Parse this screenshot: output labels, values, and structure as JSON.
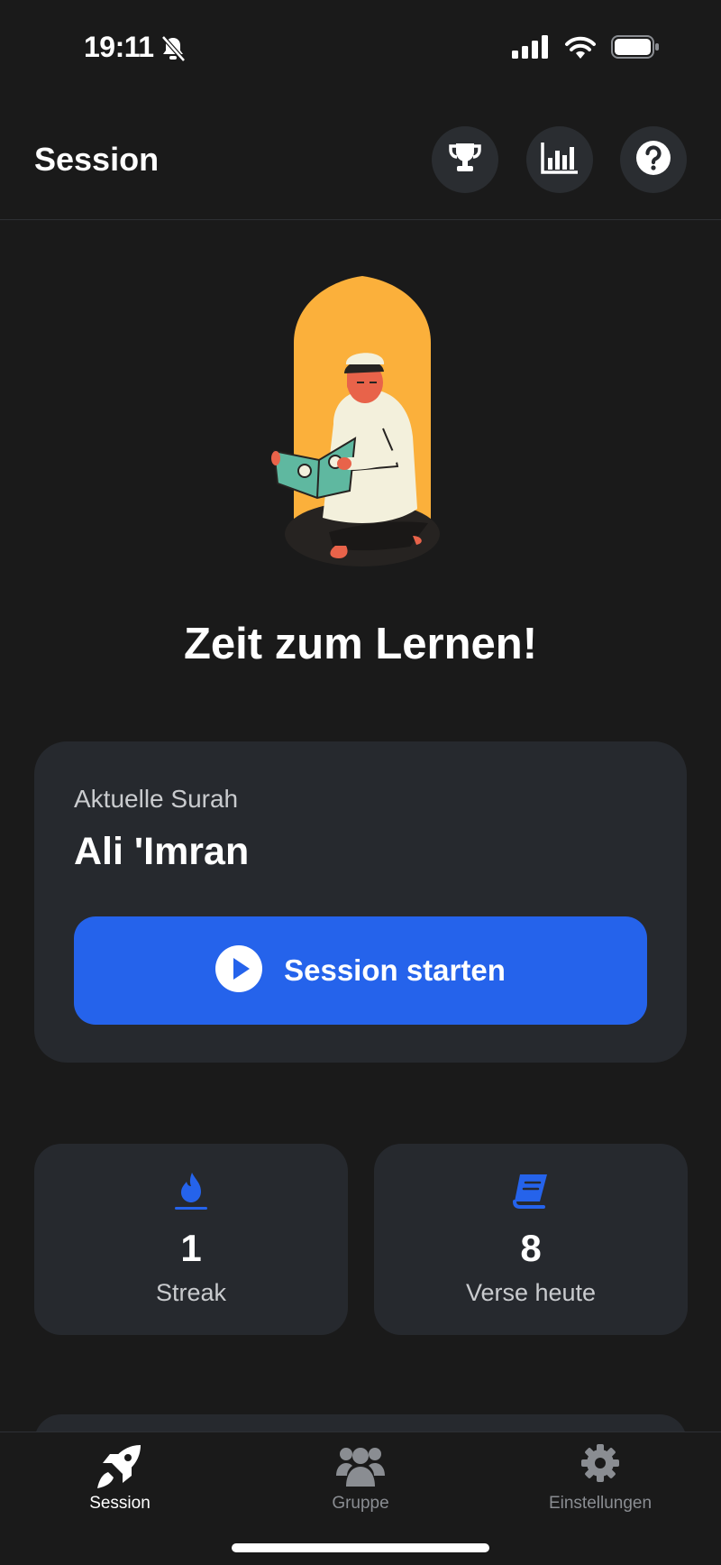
{
  "status_bar": {
    "time": "19:11"
  },
  "header": {
    "title": "Session"
  },
  "hero": {
    "title": "Zeit zum Lernen!"
  },
  "surah_card": {
    "label": "Aktuelle Surah",
    "name": "Ali 'Imran",
    "start_button": "Session starten"
  },
  "stats": [
    {
      "icon": "flame-icon",
      "value": "1",
      "label": "Streak"
    },
    {
      "icon": "book-icon",
      "value": "8",
      "label": "Verse heute"
    }
  ],
  "tabs": [
    {
      "icon": "rocket-icon",
      "label": "Session",
      "active": true
    },
    {
      "icon": "users-icon",
      "label": "Gruppe",
      "active": false
    },
    {
      "icon": "gear-icon",
      "label": "Einstellungen",
      "active": false
    }
  ],
  "colors": {
    "background": "#1a1a1a",
    "card": "#26292e",
    "accent": "#2563eb",
    "arch": "#fbb03b"
  }
}
